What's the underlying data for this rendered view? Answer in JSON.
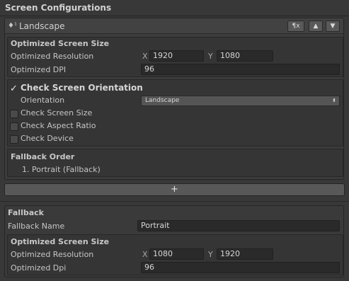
{
  "header": {
    "title": "Screen Configurations"
  },
  "config": {
    "icon_glyph": "♦¹",
    "name": "Landscape",
    "buttons": {
      "menu": "¶x",
      "up": "▲",
      "down": "▼"
    },
    "optimized": {
      "heading": "Optimized Screen Size",
      "resolution_label": "Optimized Resolution",
      "x_label": "X",
      "x_value": "1920",
      "y_label": "Y",
      "y_value": "1080",
      "dpi_label": "Optimized DPI",
      "dpi_value": "96"
    },
    "checks": {
      "orientation_label": "Check Screen Orientation",
      "orientation_checked": true,
      "orientation_field_label": "Orientation",
      "orientation_value": "Landscape",
      "screen_size_label": "Check Screen Size",
      "aspect_ratio_label": "Check Aspect Ratio",
      "device_label": "Check Device"
    },
    "fallback_order": {
      "heading": "Fallback Order",
      "items": [
        "1. Portrait (Fallback)"
      ]
    }
  },
  "add_button": {
    "label": "+"
  },
  "fallback": {
    "heading": "Fallback",
    "name_label": "Fallback Name",
    "name_value": "Portrait",
    "optimized": {
      "heading": "Optimized Screen Size",
      "resolution_label": "Optimized Resolution",
      "x_label": "X",
      "x_value": "1080",
      "y_label": "Y",
      "y_value": "1920",
      "dpi_label": "Optimized Dpi",
      "dpi_value": "96"
    }
  }
}
